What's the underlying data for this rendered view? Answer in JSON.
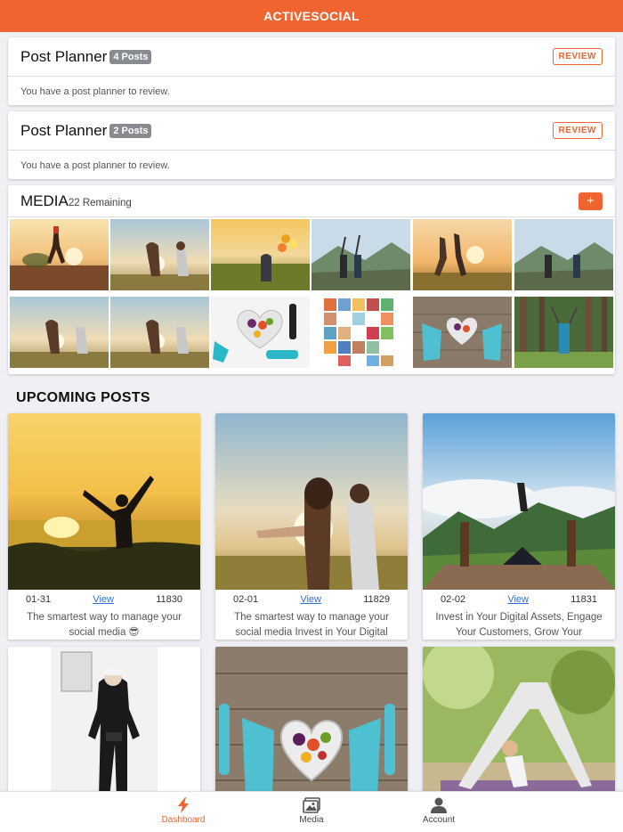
{
  "app": {
    "title": "ACTIVESOCIAL"
  },
  "planners": [
    {
      "title": "Post Planner",
      "badge": "4 Posts",
      "review_label": "REVIEW",
      "message": "You have a post planner to review."
    },
    {
      "title": "Post Planner",
      "badge": "2 Posts",
      "review_label": "REVIEW",
      "message": "You have a post planner to review."
    }
  ],
  "media": {
    "title": "MEDIA",
    "remaining": "22 Remaining",
    "add_label": "+",
    "thumbnails": [
      "runner-sunset",
      "couple-stretching-sunset",
      "woman-balloons-field",
      "women-arms-raised-mountain",
      "couple-jumping-sunset",
      "women-arms-raised-mountain",
      "couple-stretching-sunset",
      "couple-stretching-sunset",
      "heart-bowl-dumbbells",
      "fitness-collage",
      "heart-bowl-sneakers",
      "woman-arms-raised-forest"
    ]
  },
  "upcoming": {
    "title": "UPCOMING POSTS",
    "view_label": "View",
    "posts": [
      {
        "date": "01-31",
        "id": "11830",
        "caption": "The smartest way to manage your social media 😎",
        "image": "woman-sunset-lake"
      },
      {
        "date": "02-01",
        "id": "11829",
        "caption": "The smartest way to manage your social media Invest in Your Digital",
        "image": "couple-stretching-sunset"
      },
      {
        "date": "02-02",
        "id": "11831",
        "caption": "Invest in Your Digital Assets, Engage Your Customers, Grow Your",
        "image": "yoga-mountain-deck"
      },
      {
        "image": "woman-black-outfit"
      },
      {
        "image": "heart-bowl-sneakers"
      },
      {
        "image": "yoga-mother-child"
      }
    ]
  },
  "nav": {
    "items": [
      {
        "label": "Dashboard",
        "icon": "bolt-icon",
        "active": true
      },
      {
        "label": "Media",
        "icon": "image-icon",
        "active": false
      },
      {
        "label": "Account",
        "icon": "person-icon",
        "active": false
      }
    ]
  },
  "colors": {
    "accent": "#ef6431",
    "link": "#2f6fd0",
    "background": "#efeff4"
  }
}
